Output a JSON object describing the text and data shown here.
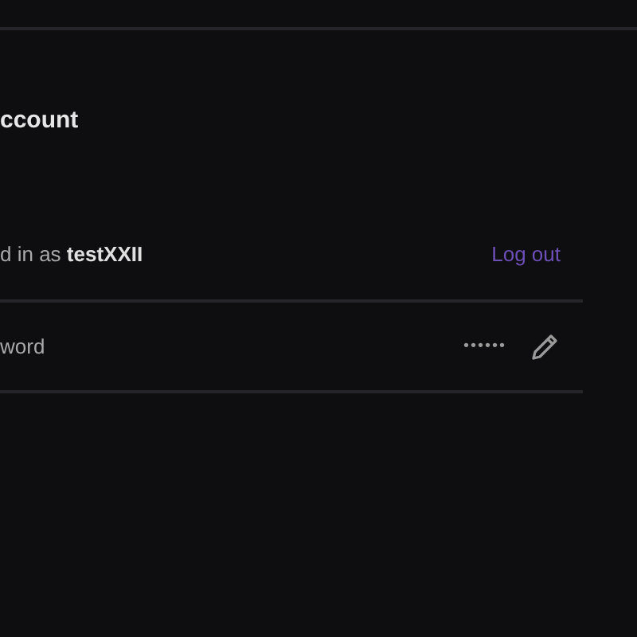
{
  "section": {
    "title": "ccount"
  },
  "login_row": {
    "text": "d in as **testXXII**",
    "action": "Log out"
  },
  "password_row": {
    "label": "word",
    "value": "••••••"
  }
}
